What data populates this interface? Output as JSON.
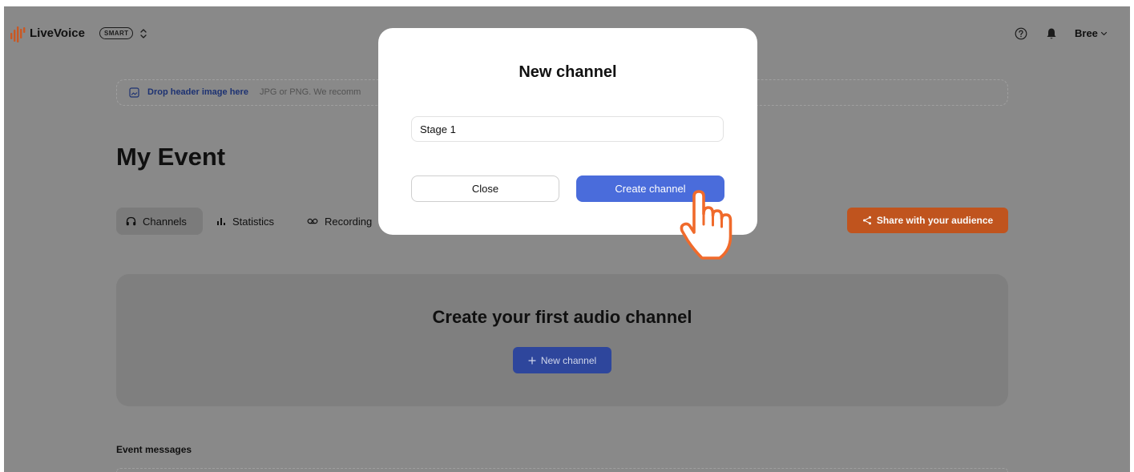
{
  "app": {
    "name": "LiveVoice",
    "plan_badge": "SMART"
  },
  "topbar": {
    "user_name": "Bree"
  },
  "header_drop": {
    "title": "Drop header image here",
    "hint": "JPG or PNG. We recomm"
  },
  "event": {
    "title": "My Event"
  },
  "tabs": [
    {
      "label": "Channels",
      "icon": "headphones-icon",
      "selected": true
    },
    {
      "label": "Statistics",
      "icon": "bar-chart-icon",
      "selected": false
    },
    {
      "label": "Recording",
      "icon": "voicemail-icon",
      "selected": false
    }
  ],
  "share_button": {
    "label": "Share with your audience",
    "icon": "share-icon"
  },
  "empty_state": {
    "title": "Create your first audio channel",
    "button_label": "New channel",
    "button_icon": "plus-icon"
  },
  "messages": {
    "heading": "Event messages"
  },
  "modal": {
    "title": "New channel",
    "input_value": "Stage 1",
    "close_label": "Close",
    "create_label": "Create channel"
  },
  "icons": {
    "logo": "livevoice-logo-icon",
    "switcher": "chevron-updown-icon",
    "help": "help-icon",
    "notifications": "bell-icon",
    "user_menu": "chevron-down-icon",
    "drop_header": "image-icon",
    "cursor": "pointer-hand-icon"
  },
  "colors": {
    "brand_orange": "#cf5a24",
    "share_orange": "#c4561f",
    "primary_blue": "#4a6cdb",
    "dimmed_blue": "#2f48a0",
    "link_blue": "#1e3375",
    "backdrop_gray": "#8c8c8c",
    "cursor_orange": "#f06a2b"
  }
}
